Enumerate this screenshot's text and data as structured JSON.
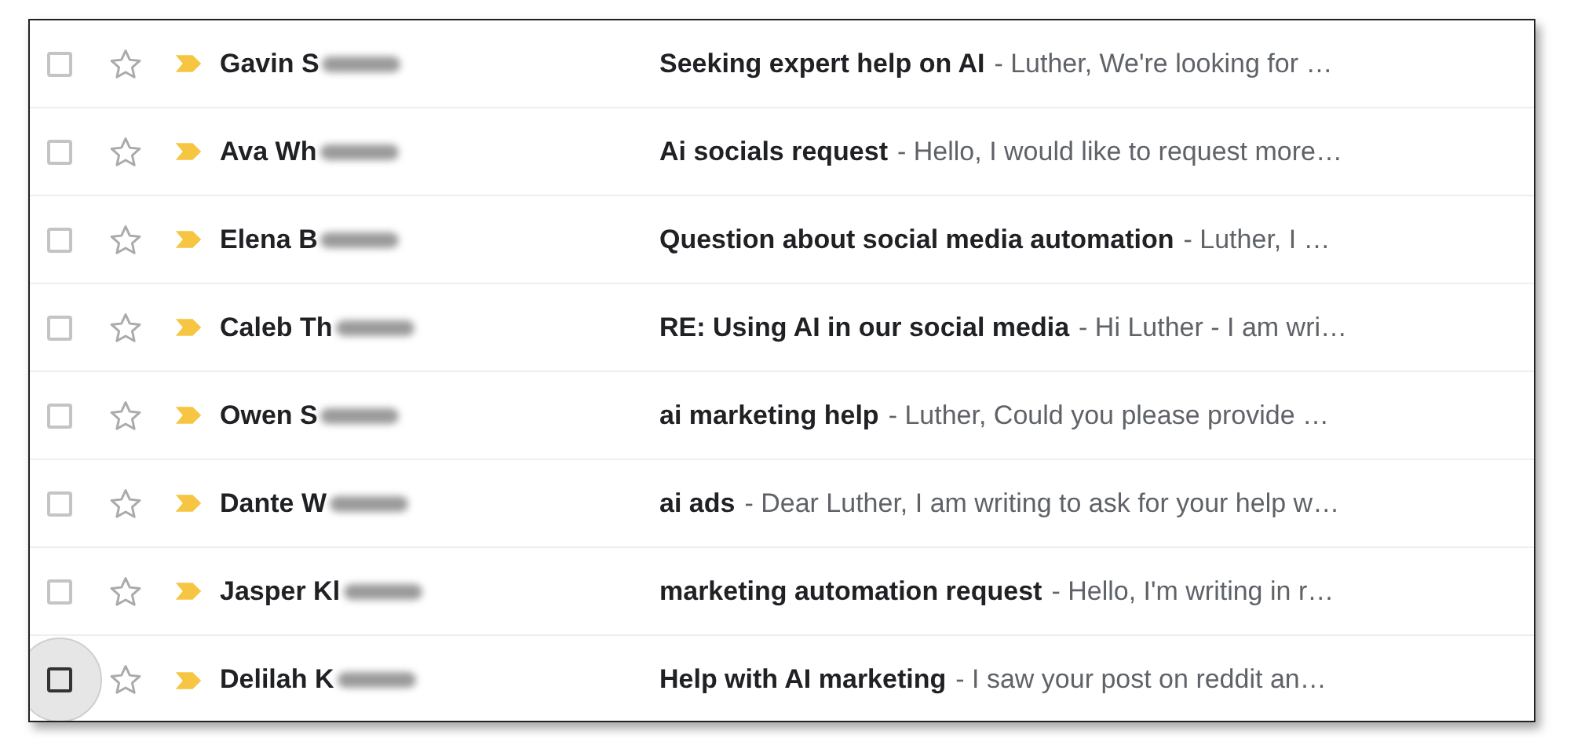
{
  "messages": [
    {
      "sender": "Gavin S",
      "subject": "Seeking expert help on AI",
      "preview": "- Luther, We're looking for …",
      "checked": false,
      "starred": false,
      "important": true,
      "hovered": false
    },
    {
      "sender": "Ava Wh",
      "subject": "Ai socials request",
      "preview": "- Hello, I would like to request more…",
      "checked": false,
      "starred": false,
      "important": true,
      "hovered": false
    },
    {
      "sender": "Elena B",
      "subject": "Question about social media automation",
      "preview": "- Luther, I …",
      "checked": false,
      "starred": false,
      "important": true,
      "hovered": false
    },
    {
      "sender": "Caleb Th",
      "subject": "RE: Using AI in our social media",
      "preview": "- Hi Luther - I am wri…",
      "checked": false,
      "starred": false,
      "important": true,
      "hovered": false
    },
    {
      "sender": "Owen S",
      "subject": "ai marketing help",
      "preview": "- Luther, Could you please provide …",
      "checked": false,
      "starred": false,
      "important": true,
      "hovered": false
    },
    {
      "sender": "Dante W",
      "subject": "ai ads",
      "preview": "- Dear Luther, I am writing to ask for your help w…",
      "checked": false,
      "starred": false,
      "important": true,
      "hovered": false
    },
    {
      "sender": "Jasper Kl",
      "subject": "marketing automation request",
      "preview": "- Hello, I'm writing in r…",
      "checked": false,
      "starred": false,
      "important": true,
      "hovered": false
    },
    {
      "sender": "Delilah K",
      "subject": "Help with AI marketing",
      "preview": "- I saw your post on reddit an…",
      "checked": false,
      "starred": false,
      "important": true,
      "hovered": true
    }
  ]
}
